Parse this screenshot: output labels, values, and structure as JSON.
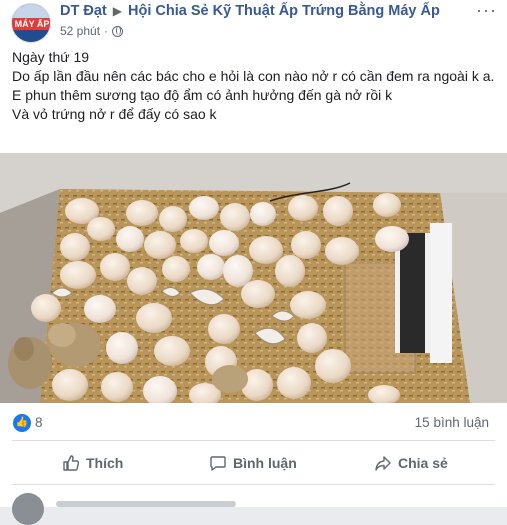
{
  "post": {
    "author": "DT Đạt",
    "separator": "▶",
    "group": "Hội Chia Sẻ Kỹ Thuật Ấp Trứng Bằng Máy Ấp",
    "time": "52 phút",
    "dot": "·",
    "privacy_icon": "globe-icon",
    "more_label": "···",
    "avatar_logo": "MÁY ẤP",
    "lines": [
      "Ngày thứ 19",
      "Do ấp lần đầu nên các bác cho e hỏi là con nào nở r có cần đem ra ngoài k a.",
      "E phun thêm sương tạo độ ẩm có ảnh hưởng đến gà nở rồi k",
      "Và vỏ trứng nở r để đấy có sao k"
    ]
  },
  "reactions": {
    "like_count": "8",
    "comments": "15 bình luận",
    "icon": "like-icon"
  },
  "actions": {
    "like": "Thích",
    "comment": "Bình luận",
    "share": "Chia sẻ"
  },
  "colors": {
    "link": "#385898",
    "muted": "#606770",
    "accent": "#1877f2"
  }
}
